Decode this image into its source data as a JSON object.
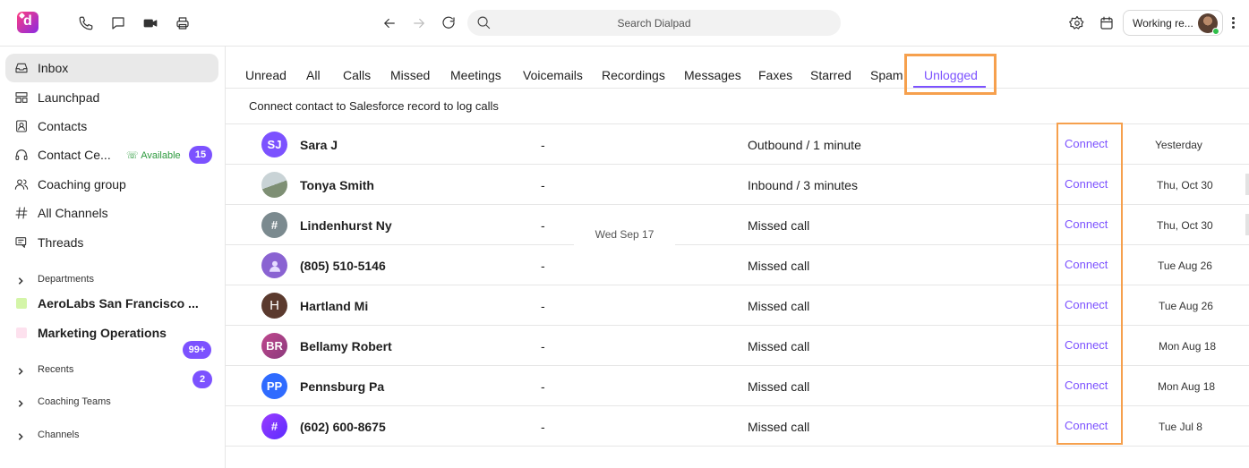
{
  "topbar": {
    "search_placeholder": "Search Dialpad",
    "status": "Working re...",
    "icons": [
      "dialpad-logo-icon",
      "phone-icon",
      "chat-icon",
      "video-icon",
      "fax-icon",
      "back-arrow-icon",
      "forward-arrow-icon",
      "refresh-icon",
      "search-icon",
      "gear-icon",
      "calendar-icon",
      "kebab-icon"
    ]
  },
  "sidebar": {
    "items": [
      {
        "label": "Inbox"
      },
      {
        "label": "Launchpad"
      },
      {
        "label": "Contacts"
      },
      {
        "label": "Contact Ce...",
        "status": "Available",
        "badge": "15"
      },
      {
        "label": "Coaching group"
      },
      {
        "label": "All Channels"
      },
      {
        "label": "Threads"
      }
    ],
    "sections": {
      "departments": "Departments",
      "recents": "Recents",
      "coaching_teams": "Coaching Teams",
      "channels": "Channels"
    },
    "departments": [
      {
        "label": "AeroLabs San Francisco ...",
        "badge": "99+",
        "color": "#d4f5a8"
      },
      {
        "label": "Marketing Operations",
        "badge": "2",
        "color": "#fde1ee"
      }
    ]
  },
  "tabs": [
    "Unread",
    "All",
    "Calls",
    "Missed",
    "Meetings",
    "Voicemails",
    "Recordings",
    "Messages",
    "Faxes",
    "Starred",
    "Spam",
    "Unlogged"
  ],
  "active_tab": "Unlogged",
  "subtitle": "Connect contact to Salesforce record to log calls",
  "date_chip": "Wed Sep 17",
  "connect_label": "Connect",
  "rows": [
    {
      "initials": "SJ",
      "name": "Sara J",
      "dash": "-",
      "detail": "Outbound / 1 minute",
      "date": "Yesterday",
      "color": "#7c52ff"
    },
    {
      "initials": "",
      "name": "Tonya Smith",
      "dash": "-",
      "detail": "Inbound / 3 minutes",
      "date": "Thu, Oct 30",
      "color": "#9aa5a8"
    },
    {
      "initials": "#",
      "name": "Lindenhurst Ny",
      "dash": "-",
      "detail": "Missed call",
      "date": "Thu, Oct 30",
      "color": "#7b8a8f"
    },
    {
      "initials": "",
      "name": "(805) 510-5146",
      "dash": "-",
      "detail": "Missed call",
      "date": "Tue Aug 26",
      "color": "#8a63d2"
    },
    {
      "initials": "H",
      "name": "Hartland Mi",
      "dash": "-",
      "detail": "Missed call",
      "date": "Tue Aug 26",
      "color": "#5b3a2e"
    },
    {
      "initials": "BR",
      "name": "Bellamy Robert",
      "dash": "-",
      "detail": "Missed call",
      "date": "Mon Aug 18",
      "color": "#b04a8a"
    },
    {
      "initials": "PP",
      "name": "Pennsburg Pa",
      "dash": "-",
      "detail": "Missed call",
      "date": "Mon Aug 18",
      "color": "#2f6bff"
    },
    {
      "initials": "#",
      "name": "(602) 600-8675",
      "dash": "-",
      "detail": "Missed call",
      "date": "Tue Jul 8",
      "color": "#7a2cff"
    }
  ]
}
